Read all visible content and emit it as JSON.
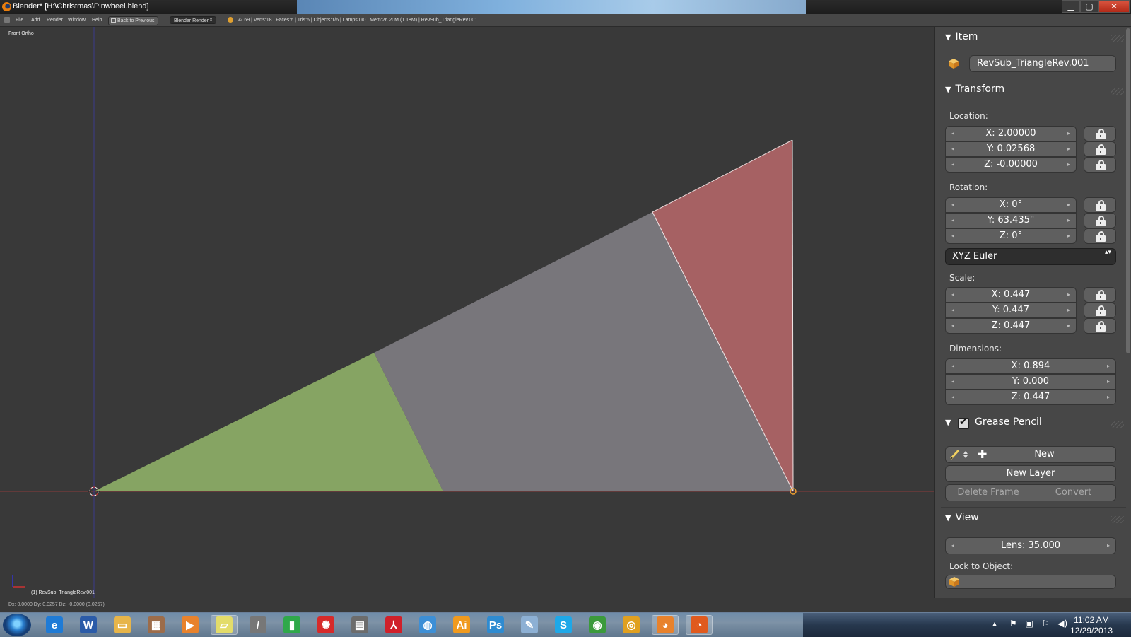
{
  "window": {
    "title": "Blender* [H:\\Christmas\\Pinwheel.blend]",
    "controls": {
      "minimize": "▁",
      "maximize": "▢",
      "close": "✕"
    }
  },
  "header": {
    "menus": [
      "File",
      "Add",
      "Render",
      "Window",
      "Help"
    ],
    "back_button": "Back to Previous",
    "render_engine": "Blender Render",
    "render_engine_arrow": "⬍",
    "stats": "v2.69 | Verts:18 | Faces:6 | Tris:6 | Objects:1/6 | Lamps:0/0 | Mem:26.20M (1.18M) | RevSub_TriangleRev.001"
  },
  "viewport": {
    "view_name": "Front Ortho",
    "object_label": "(1) RevSub_TriangleRev.001",
    "status": "Dx: 0.0000  Dy: 0.0257  Dz: -0.0000 (0.0257)",
    "colors": {
      "green_face": "#86a463",
      "gray_face": "#78767b",
      "red_face": "#a66163",
      "background": "#393939"
    }
  },
  "panel": {
    "item": {
      "title": "Item",
      "object_name": "RevSub_TriangleRev.001"
    },
    "transform": {
      "title": "Transform",
      "location_label": "Location:",
      "location": [
        "X: 2.00000",
        "Y: 0.02568",
        "Z: -0.00000"
      ],
      "rotation_label": "Rotation:",
      "rotation": [
        "X: 0°",
        "Y: 63.435°",
        "Z: 0°"
      ],
      "rotation_mode": "XYZ Euler",
      "rotation_mode_arrow": "▴▾",
      "scale_label": "Scale:",
      "scale": [
        "X: 0.447",
        "Y: 0.447",
        "Z: 0.447"
      ],
      "dimensions_label": "Dimensions:",
      "dimensions": [
        "X: 0.894",
        "Y: 0.000",
        "Z: 0.447"
      ]
    },
    "grease_pencil": {
      "title": "Grease Pencil",
      "new_button": "New",
      "new_layer_button": "New Layer",
      "delete_frame_button": "Delete Frame",
      "convert_button": "Convert"
    },
    "view": {
      "title": "View",
      "lens": "Lens: 35.000",
      "lock_to_object_label": "Lock to Object:"
    }
  },
  "taskbar": {
    "icons": [
      {
        "name": "internet-explorer-icon",
        "glyph": "e",
        "color": "#1f7bd6"
      },
      {
        "name": "word-icon",
        "glyph": "W",
        "color": "#2b5ba8"
      },
      {
        "name": "file-explorer-icon",
        "glyph": "▭",
        "color": "#e7b54a"
      },
      {
        "name": "archive-icon",
        "glyph": "▦",
        "color": "#9c6c4a"
      },
      {
        "name": "media-player-icon",
        "glyph": "▶",
        "color": "#e8822c"
      },
      {
        "name": "sticky-notes-icon",
        "glyph": "▱",
        "color": "#e3dc6a"
      },
      {
        "name": "microphone-icon",
        "glyph": "/",
        "color": "#777777"
      },
      {
        "name": "battery-icon",
        "glyph": "▮",
        "color": "#2fa84a"
      },
      {
        "name": "cbc-icon",
        "glyph": "✺",
        "color": "#d62a2a"
      },
      {
        "name": "scanner-icon",
        "glyph": "▤",
        "color": "#6c6c6c"
      },
      {
        "name": "acrobat-icon",
        "glyph": "⅄",
        "color": "#d0202a"
      },
      {
        "name": "globe-icon",
        "glyph": "◍",
        "color": "#3d8fd6"
      },
      {
        "name": "illustrator-icon",
        "glyph": "Ai",
        "color": "#f09a1e"
      },
      {
        "name": "photoshop-icon",
        "glyph": "Ps",
        "color": "#2e8bd1"
      },
      {
        "name": "paint-icon",
        "glyph": "✎",
        "color": "#8db0d4"
      },
      {
        "name": "skype-icon",
        "glyph": "S",
        "color": "#1ea8e8"
      },
      {
        "name": "chrome-icon",
        "glyph": "◉",
        "color": "#3b9a3b"
      },
      {
        "name": "target-app-icon",
        "glyph": "◎",
        "color": "#e0a020"
      },
      {
        "name": "blender-icon",
        "glyph": "◕",
        "color": "#e8822c"
      },
      {
        "name": "firefox-icon",
        "glyph": "◔",
        "color": "#e05a1e"
      }
    ],
    "clock_time": "11:02 AM",
    "clock_date": "12/29/2013"
  }
}
